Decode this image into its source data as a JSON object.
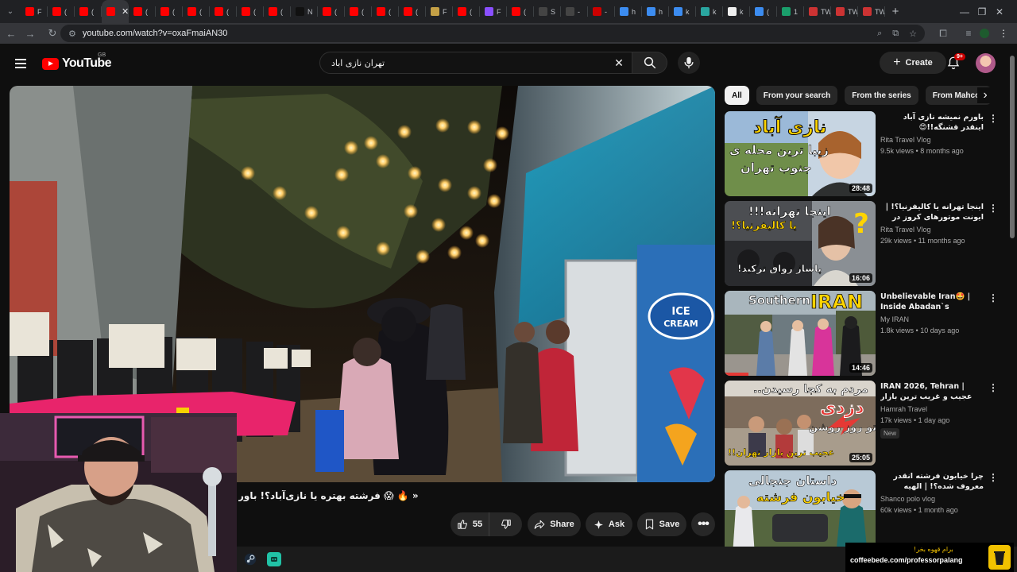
{
  "browser": {
    "url": "youtube.com/watch?v=oxaFmaiAN30",
    "tabs": [
      {
        "label": "F",
        "color": "#ff0000"
      },
      {
        "label": "(",
        "color": "#ff0000"
      },
      {
        "label": "(",
        "color": "#ff0000"
      },
      {
        "label": "",
        "color": "#ff0000",
        "active": true
      },
      {
        "label": "(",
        "color": "#ff0000"
      },
      {
        "label": "(",
        "color": "#ff0000"
      },
      {
        "label": "(",
        "color": "#ff0000"
      },
      {
        "label": "(",
        "color": "#ff0000"
      },
      {
        "label": "(",
        "color": "#ff0000"
      },
      {
        "label": "(",
        "color": "#ff0000"
      },
      {
        "label": "N",
        "color": "#111111"
      },
      {
        "label": "(",
        "color": "#ff0000"
      },
      {
        "label": "(",
        "color": "#ff0000"
      },
      {
        "label": "(",
        "color": "#ff0000"
      },
      {
        "label": "(",
        "color": "#ff0000"
      },
      {
        "label": "F",
        "color": "#c4a046"
      },
      {
        "label": "(",
        "color": "#ff0000"
      },
      {
        "label": "F",
        "color": "#8a4fff"
      },
      {
        "label": "(",
        "color": "#ff0000"
      },
      {
        "label": "S",
        "color": "#444444"
      },
      {
        "label": "-",
        "color": "#444444"
      },
      {
        "label": "-",
        "color": "#cc0000"
      },
      {
        "label": "h",
        "color": "#3c8cf0"
      },
      {
        "label": "h",
        "color": "#3c8cf0"
      },
      {
        "label": "k",
        "color": "#3c8cf0"
      },
      {
        "label": "k",
        "color": "#2aa6a0"
      },
      {
        "label": "k",
        "color": "#eeeeee"
      },
      {
        "label": "(",
        "color": "#3c8cf0"
      },
      {
        "label": "1",
        "color": "#1a9e6b"
      },
      {
        "label": "TW",
        "color": "#cc3333"
      },
      {
        "label": "TW",
        "color": "#cc3333"
      },
      {
        "label": "TW",
        "color": "#cc3333"
      }
    ]
  },
  "youtube": {
    "logo": "YouTube",
    "region": "GB",
    "search_query": "تهران نازی اباد",
    "create_label": "Create",
    "notification_count": "9+"
  },
  "video": {
    "title": "« 🔥 😱 فرشته بهتره یا نازی‌آباد؟! باور",
    "like_count": "55",
    "share_label": "Share",
    "ask_label": "Ask",
    "save_label": "Save"
  },
  "related": {
    "chips": [
      "All",
      "From your search",
      "From the series",
      "From Mahcop"
    ],
    "items": [
      {
        "title": "باورم نمیشه نازی آباد اینقدر قشنگه!!😍",
        "rtl": true,
        "channel": "Rita Travel Vlog",
        "views": "9.5k views",
        "age": "8 months ago",
        "duration": "28:48",
        "thumb_text_1": "نازی آباد",
        "thumb_text_2": "زیبا ترین محله ی",
        "thumb_text_3": "جنوب تهران"
      },
      {
        "title": "اینجا تهرانه یا کالیفرنیا؟! | ایونت موتورهای کروز در رواق مال 🔥🏍",
        "rtl": true,
        "channel": "Rita Travel Vlog",
        "views": "29k views",
        "age": "11 months ago",
        "duration": "16:06",
        "thumb_text_1": "اینجا تهرانه!!!",
        "thumb_text_2": "یا کالیفرنیا؟!",
        "thumb_text_3": "پاساژ رواق ترکید!"
      },
      {
        "title": "Unbelievable Iran🤩 | Inside Abadan`s Biggest ...",
        "rtl": false,
        "channel": "My IRAN",
        "views": "1.8k views",
        "age": "10 days ago",
        "duration": "14:46",
        "thumb_text_1": "Southern",
        "thumb_text_2": "IRAN"
      },
      {
        "title": "IRAN 2026, Tehran | عجیب و غریب ترین بازار تهران!! باورکردنیه",
        "rtl": false,
        "channel": "Hamrah Travel",
        "views": "17k views",
        "age": "1 day ago",
        "badge": "New",
        "duration": "25:05",
        "thumb_text_1": "مردم به کجا رسیدن..",
        "thumb_text_2": "دزدی",
        "thumb_text_3": "تو روز روشن",
        "thumb_text_4": "عجیب ترین بازار تهران!!"
      },
      {
        "title": "چرا خیابون فرشته انقدر معروف شده؟! | الهیه تهران",
        "rtl": true,
        "channel": "Shanco polo vlog",
        "views": "60k views",
        "age": "1 month ago",
        "thumb_text_1": "داستان جنجالی",
        "thumb_text_2": "خیابون فرشته"
      }
    ]
  },
  "sponsor": {
    "line1": "برام قهوه بخر!",
    "line2": "coffeebede.com/professorpalang"
  }
}
